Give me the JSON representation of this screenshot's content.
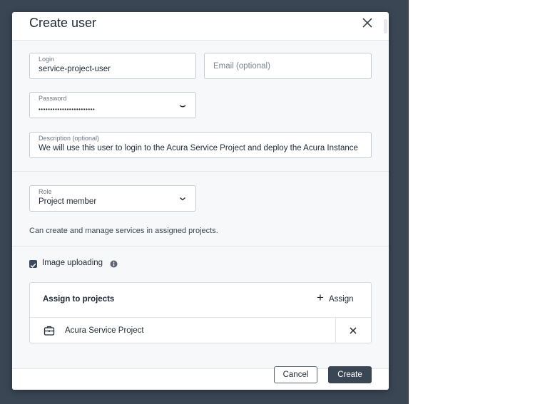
{
  "dialog": {
    "title": "Create user"
  },
  "form": {
    "login": {
      "label": "Login",
      "value": "service-project-user"
    },
    "email": {
      "placeholder": "Email (optional)"
    },
    "password": {
      "label": "Password",
      "value": "••••••••••••••••••••••••"
    },
    "description": {
      "label": "Description (optional)",
      "value": "We will use this user to login to the Acura Service Project and deploy the Acura Instance"
    },
    "role": {
      "label": "Role",
      "value": "Project member"
    },
    "role_help": "Can create and manage services in assigned projects.",
    "image_uploading": {
      "label": "Image uploading",
      "checked": true
    }
  },
  "projects": {
    "header": "Assign to projects",
    "assign_label": "Assign",
    "items": [
      {
        "name": "Acura Service Project"
      }
    ]
  },
  "footer": {
    "cancel_label": "Cancel",
    "create_label": "Create"
  },
  "icons": {
    "close": "close-icon",
    "password_toggle": "eye-closed-icon",
    "role_dropdown": "chevron-down-icon",
    "checkbox": "check-icon",
    "info": "info-icon",
    "assign": "plus-icon",
    "project": "briefcase-icon",
    "remove": "close-icon"
  },
  "colors": {
    "backdrop": "#3a4654",
    "primary": "#3a4654",
    "checkbox": "#3a4a5c"
  }
}
